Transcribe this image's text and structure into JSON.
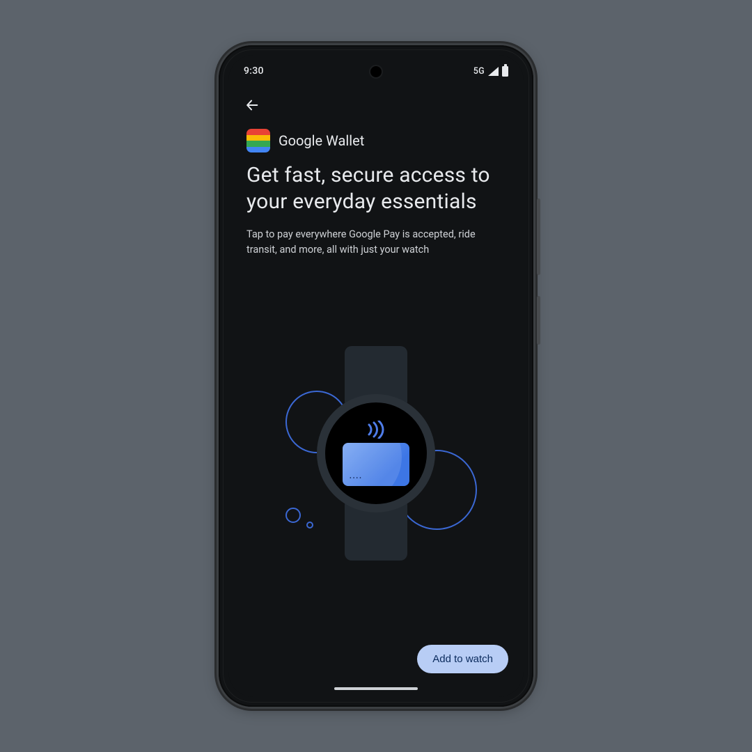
{
  "statusbar": {
    "time": "9:30",
    "network": "5G"
  },
  "app": {
    "name": "Google Wallet",
    "icon_colors": [
      "#e94335",
      "#fbbc05",
      "#34a853",
      "#4285f4"
    ]
  },
  "headline": "Get fast, secure access to your everyday essentials",
  "subtext": "Tap to pay everywhere Google Pay is accepted, ride transit, and more, all with just your watch",
  "illustration": {
    "card_dots": "••••"
  },
  "cta_label": "Add to watch",
  "colors": {
    "accent_blue": "#3b68d4",
    "cta_bg": "#b8cdf5",
    "cta_fg": "#0a2a5c"
  }
}
